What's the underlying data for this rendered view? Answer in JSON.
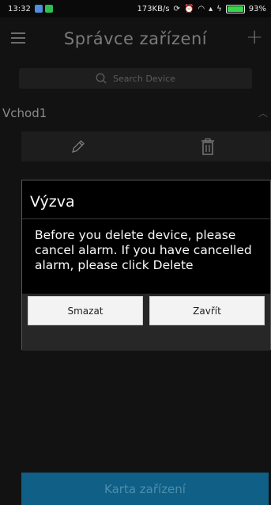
{
  "status_bar": {
    "time": "13:32",
    "network_speed": "173KB/s",
    "battery_percent": "93%",
    "battery_level": 0.93
  },
  "app_bar": {
    "title": "Správce zařízení",
    "menu_icon": "hamburger-menu-icon",
    "add_icon": "plus-icon"
  },
  "search": {
    "placeholder": "Search Device",
    "icon": "search-icon"
  },
  "device_group": {
    "name": "Vchod1",
    "expand_icon": "chevron-up-icon",
    "actions": {
      "edit_icon": "pencil-icon",
      "delete_icon": "trash-icon"
    }
  },
  "dialog": {
    "title": "Výzva",
    "message": "Before you delete device, please cancel alarm. If you have cancelled alarm, please click Delete",
    "buttons": {
      "delete_label": "Smazat",
      "close_label": "Zavřít"
    }
  },
  "bottom_bar": {
    "label": "Karta zařízení"
  },
  "colors": {
    "background": "#121212",
    "primary_button": "#0f5f87",
    "battery_green": "#37d64a"
  }
}
